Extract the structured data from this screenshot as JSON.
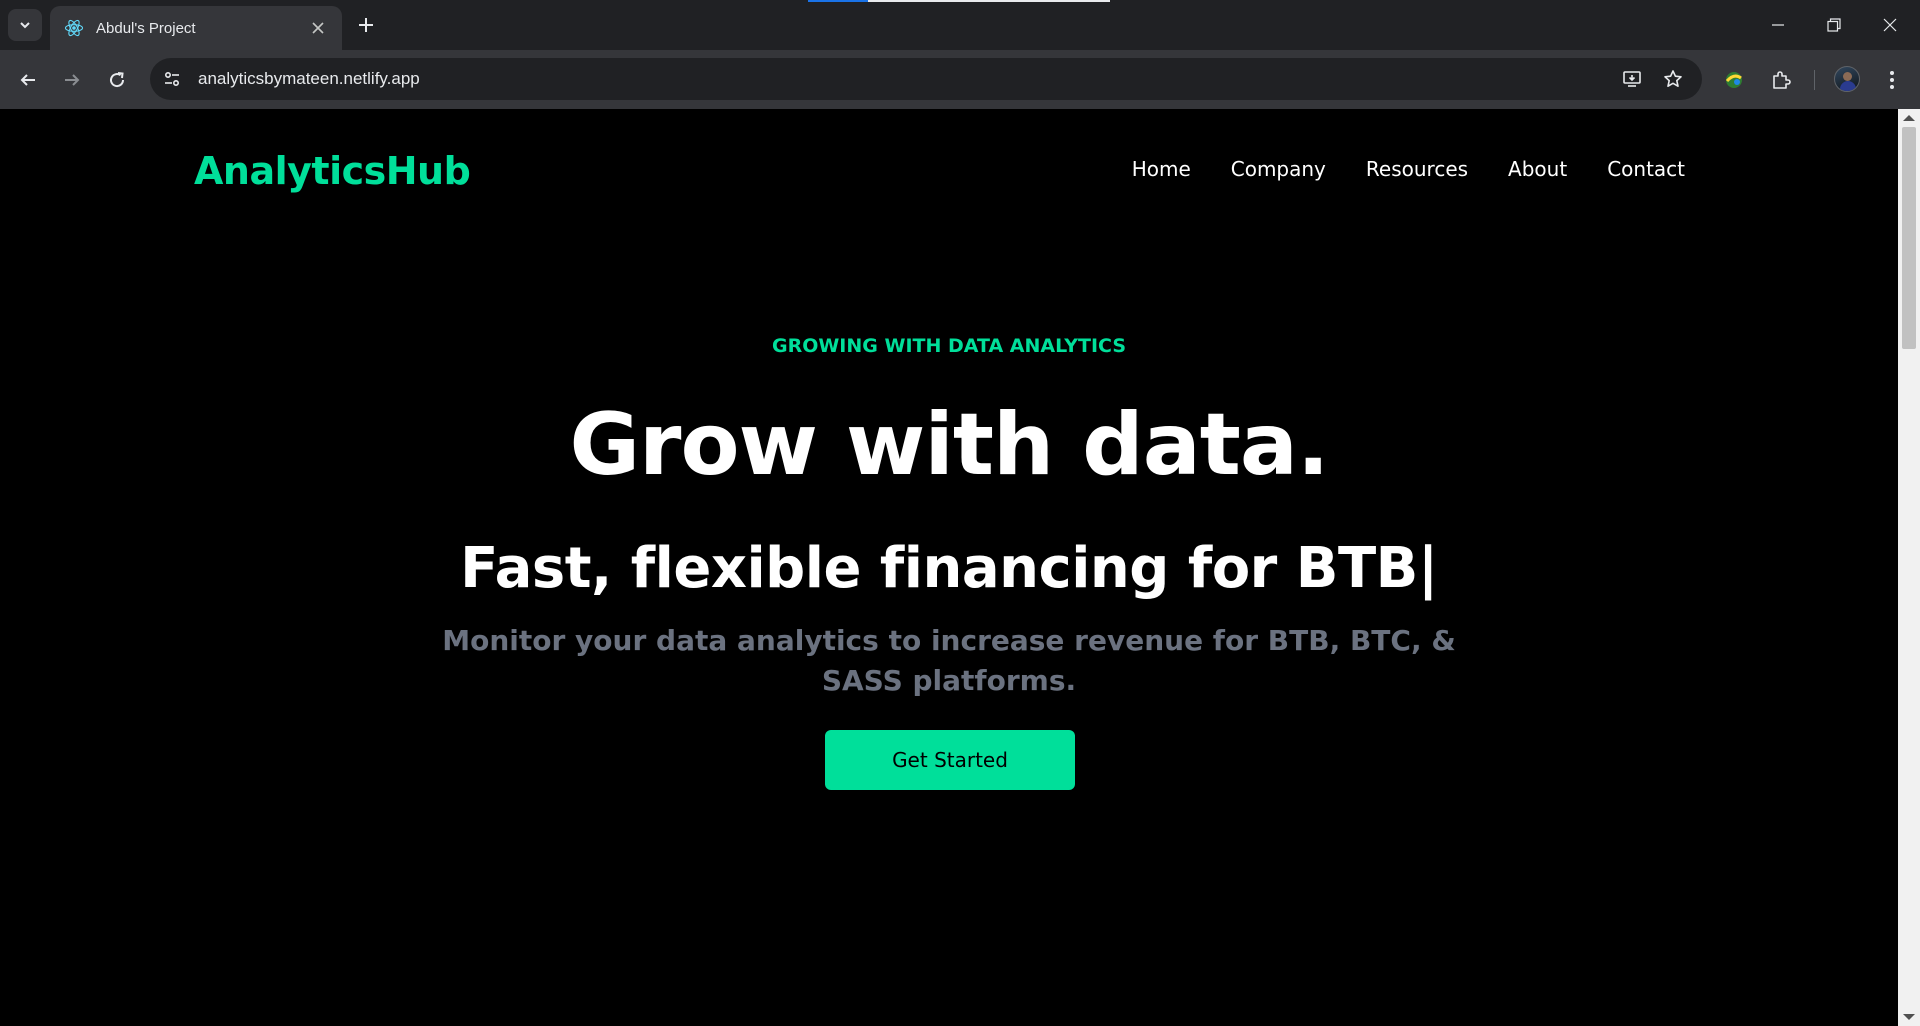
{
  "browser": {
    "tab": {
      "title": "Abdul's Project",
      "favicon": "react-atom-icon"
    },
    "address_bar": {
      "url": "analyticsbymateen.netlify.app"
    },
    "icons": {
      "tab_search": "chevron-down-icon",
      "close_tab": "close-icon",
      "new_tab": "plus-icon",
      "back": "arrow-left-icon",
      "forward": "arrow-right-icon",
      "reload": "reload-icon",
      "site_info": "tune-icon",
      "install": "install-app-icon",
      "bookmark": "star-icon",
      "extension": "puzzle-icon",
      "profile": "avatar",
      "menu": "kebab-menu-icon"
    },
    "colors": {
      "tabstrip": "#202124",
      "toolbar": "#35363a"
    }
  },
  "page": {
    "logo": "AnalyticsHub",
    "nav": [
      "Home",
      "Company",
      "Resources",
      "About",
      "Contact"
    ],
    "eyebrow": "GROWING WITH DATA ANALYTICS",
    "headline": "Grow with data.",
    "typed_text": "Fast, flexible financing for BTB|",
    "subtitle": "Monitor your data analytics to increase revenue for BTB, BTC, & SASS platforms.",
    "cta_label": "Get Started",
    "colors": {
      "accent": "#00df9a",
      "background": "#000000",
      "subtitle": "#6b7280"
    }
  }
}
